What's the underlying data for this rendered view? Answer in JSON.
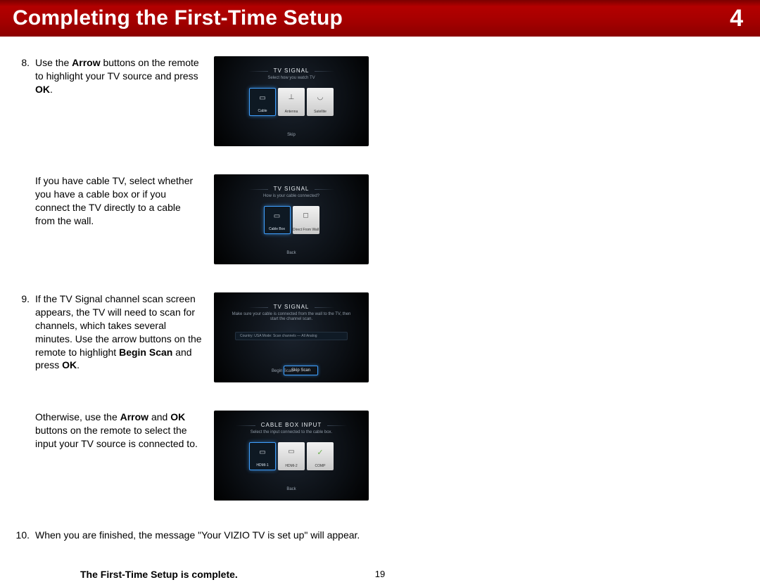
{
  "header": {
    "title": "Completing the First-Time Setup",
    "chapter_number": "4"
  },
  "steps": {
    "eight": {
      "num": "8.",
      "text_parts": [
        "Use the ",
        "Arrow",
        " buttons on the remote to highlight your TV source and press ",
        "OK",
        "."
      ],
      "sub_text": "If you have cable TV, select whether you have a cable box or if you connect the TV directly to a cable from the wall."
    },
    "nine": {
      "num": "9.",
      "text_parts": [
        "If the TV Signal channel scan screen appears, the TV will need to scan for channels, which takes several minutes. Use the arrow buttons on the remote to highlight ",
        "Begin Scan",
        " and press ",
        "OK",
        "."
      ],
      "sub_parts": [
        "Otherwise, use the ",
        "Arrow",
        " and ",
        "OK",
        " buttons on the remote to select the input your TV source is connected to."
      ]
    },
    "ten": {
      "num": "10.",
      "text": "When you are finished, the message \"Your VIZIO TV is set up\" will appear."
    }
  },
  "tv_screens": {
    "signal_source": {
      "title": "TV SIGNAL",
      "subtitle": "Select how you watch TV",
      "tiles": [
        {
          "label": "Cable",
          "icon": "▭",
          "selected": true
        },
        {
          "label": "Antenna",
          "icon": "⊥",
          "selected": false
        },
        {
          "label": "Satellite",
          "icon": "◡",
          "selected": false
        }
      ],
      "nav_button": "Skip"
    },
    "cable_connect": {
      "title": "TV SIGNAL",
      "subtitle": "How is your cable connected?",
      "tiles": [
        {
          "label": "Cable Box",
          "icon": "▭",
          "selected": true
        },
        {
          "label": "Direct From Wall",
          "icon": "◻",
          "selected": false
        }
      ],
      "nav_button": "Back"
    },
    "channel_scan": {
      "title": "TV SIGNAL",
      "subtitle": "Make sure your cable is connected from the wall to the TV, then start the channel scan.",
      "dropdown": "Country: USA    Mode: Scan channels — All Analog",
      "nav_left": "Begin Scan",
      "nav_right": "Skip Scan"
    },
    "cable_box_input": {
      "title": "CABLE BOX INPUT",
      "subtitle": "Select the input connected to the cable box.",
      "tiles": [
        {
          "label": "HDMI-1",
          "icon": "▭",
          "selected": true,
          "green": false
        },
        {
          "label": "HDMI-2",
          "icon": "▭",
          "selected": false,
          "green": false
        },
        {
          "label": "COMP",
          "icon": "✓",
          "selected": false,
          "green": true
        }
      ],
      "nav_button": "Back"
    }
  },
  "completion_line": "The First-Time Setup is complete.",
  "page_number": "19"
}
